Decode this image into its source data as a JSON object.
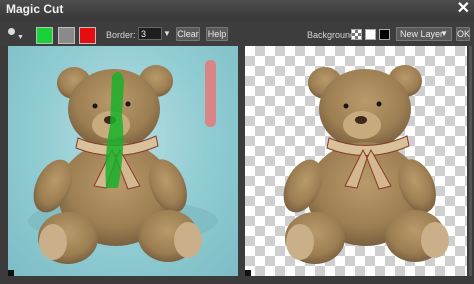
{
  "window": {
    "title": "Magic Cut",
    "close_label": "✕"
  },
  "toolbar": {
    "swatch_colors": {
      "foreground": "#19d13a",
      "neutral": "#8a8a8a",
      "background": "#e60d10"
    },
    "border_label": "Border:",
    "border_value": "3",
    "clear_label": "Clear",
    "help_label": "Help",
    "background_label": "Background:",
    "layer_select": "New Layer",
    "ok_label": "OK"
  },
  "icons": [
    "brush-icon",
    "chevron-down-icon",
    "close-icon",
    "checker-background-icon"
  ],
  "colors": {
    "window_bg": "#3b3b3b",
    "foreground_stroke": "#2bb52d",
    "background_stroke": "#d98585"
  }
}
